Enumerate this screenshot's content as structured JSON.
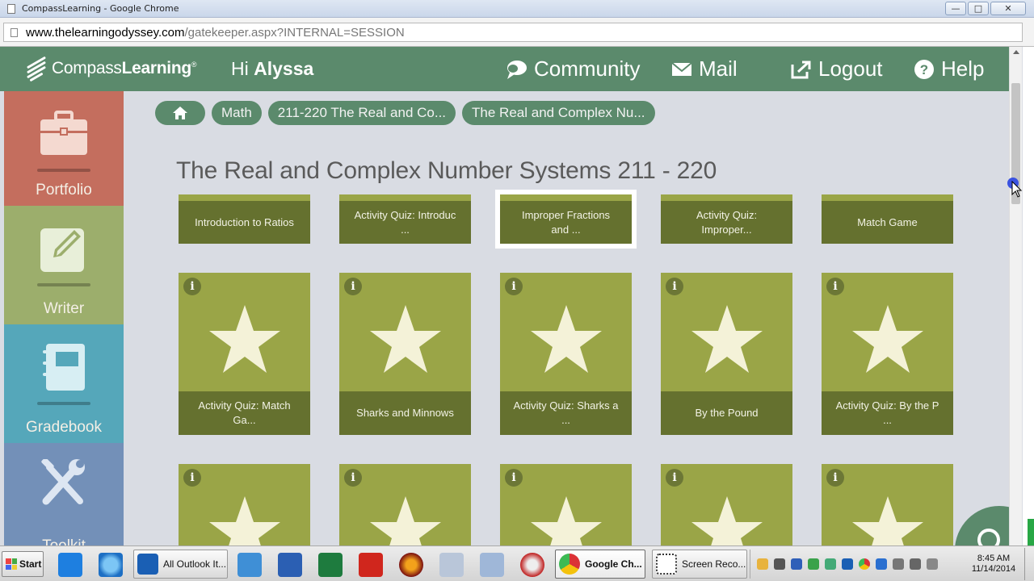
{
  "window": {
    "title": "CompassLearning - Google Chrome",
    "url_host": "www.thelearningodyssey.com",
    "url_path": "/gatekeeper.aspx?INTERNAL=SESSION",
    "controls": [
      "—",
      "□",
      "✕"
    ]
  },
  "header": {
    "logo_prefix": "Compass",
    "logo_bold": "Learning",
    "logo_reg": "®",
    "greeting_prefix": "Hi ",
    "user_name": "Alyssa",
    "nav": {
      "community": "Community",
      "mail": "Mail",
      "logout": "Logout",
      "help": "Help"
    },
    "color": "#5b8a6c"
  },
  "sidebar": {
    "items": [
      {
        "label": "Portfolio",
        "icon": "briefcase-icon",
        "color": "#c46e5e"
      },
      {
        "label": "Writer",
        "icon": "edit-icon",
        "color": "#9cae6c"
      },
      {
        "label": "Gradebook",
        "icon": "notebook-icon",
        "color": "#55a7ba"
      },
      {
        "label": "Toolkit",
        "icon": "tools-icon",
        "color": "#7390b8"
      }
    ]
  },
  "breadcrumbs": [
    "Math",
    "211-220 The Real and Co...",
    "The Real and Complex Nu..."
  ],
  "page_title": "The Real and Complex Number Systems 211 - 220",
  "top_row": [
    {
      "line1": "Introduction to Ratios",
      "line2": ""
    },
    {
      "line1": "Activity Quiz: Introduc",
      "line2": "..."
    },
    {
      "line1": "Improper Fractions",
      "line2": "and ...",
      "selected": true
    },
    {
      "line1": "Activity Quiz:",
      "line2": "Improper..."
    },
    {
      "line1": "Match Game",
      "line2": ""
    }
  ],
  "middle_row": [
    {
      "line1": "Activity Quiz: Match",
      "line2": "Ga..."
    },
    {
      "line1": "Sharks and Minnows",
      "line2": ""
    },
    {
      "line1": "Activity Quiz: Sharks a",
      "line2": "..."
    },
    {
      "line1": "By the Pound",
      "line2": ""
    },
    {
      "line1": "Activity Quiz: By the P",
      "line2": "..."
    }
  ],
  "info_glyph": "i",
  "taskbar": {
    "start": "Start",
    "buttons": [
      "All Outlook It...",
      "Google Ch...",
      "Screen Reco..."
    ],
    "clock_time": "8:45 AM",
    "clock_date": "11/14/2014"
  }
}
